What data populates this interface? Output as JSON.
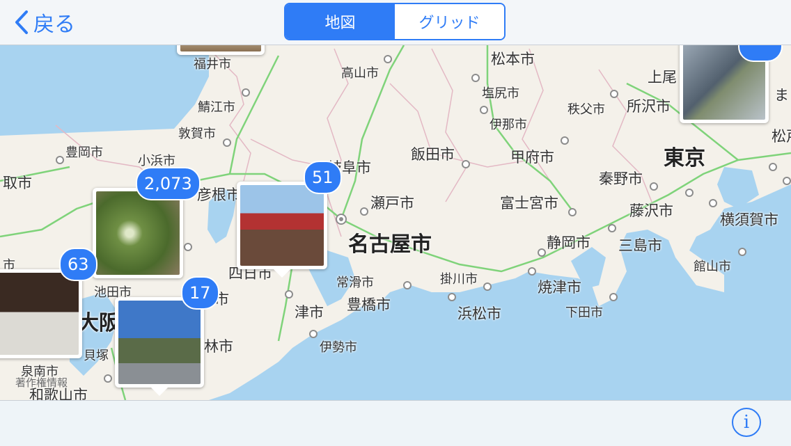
{
  "nav": {
    "back_label": "戻る",
    "segments": [
      {
        "label": "地図",
        "selected": true
      },
      {
        "label": "グリッド",
        "selected": false
      }
    ]
  },
  "map": {
    "cities": [
      {
        "name": "福井市"
      },
      {
        "name": "高山市"
      },
      {
        "name": "松本市"
      },
      {
        "name": "上尾"
      },
      {
        "name": "鯖江市"
      },
      {
        "name": "塩尻市"
      },
      {
        "name": "秩父市"
      },
      {
        "name": "所沢市"
      },
      {
        "name": "敦賀市"
      },
      {
        "name": "伊那市"
      },
      {
        "name": "松戸"
      },
      {
        "name": "豊岡市"
      },
      {
        "name": "小浜市"
      },
      {
        "name": "岐阜市"
      },
      {
        "name": "飯田市"
      },
      {
        "name": "甲府市"
      },
      {
        "name": "東京"
      },
      {
        "name": "取市"
      },
      {
        "name": "彦根市"
      },
      {
        "name": "瀬戸市"
      },
      {
        "name": "富士宮市"
      },
      {
        "name": "秦野市"
      },
      {
        "name": "名古屋市"
      },
      {
        "name": "藤沢市"
      },
      {
        "name": "横須賀市"
      },
      {
        "name": "静岡市"
      },
      {
        "name": "三島市"
      },
      {
        "name": "四日市"
      },
      {
        "name": "常滑市"
      },
      {
        "name": "掛川市"
      },
      {
        "name": "焼津市"
      },
      {
        "name": "館山市"
      },
      {
        "name": "池田市"
      },
      {
        "name": "豊橋市"
      },
      {
        "name": "津市"
      },
      {
        "name": "浜松市"
      },
      {
        "name": "下田市"
      },
      {
        "name": "大阪"
      },
      {
        "name": "伊勢市"
      },
      {
        "name": "林市"
      },
      {
        "name": "貝塚"
      },
      {
        "name": "泉南市"
      },
      {
        "name": "和歌山市"
      },
      {
        "name": "市"
      },
      {
        "name": "市"
      },
      {
        "name": "ま"
      }
    ],
    "clusters": [
      {
        "count": "2,073",
        "photo_color": "#5c7a3e"
      },
      {
        "count": "51",
        "photo_color": "#b03a3a"
      },
      {
        "count": "63",
        "photo_color": "#8a6a4a"
      },
      {
        "count": "17",
        "photo_color": "#4a6fa8"
      }
    ],
    "credit": "著作権情報"
  },
  "bottom": {
    "info_icon": "info-icon"
  },
  "colors": {
    "accent": "#2f7cf6",
    "sea": "#a8d3f0",
    "land": "#f4f1ea",
    "road": "#7fd37a",
    "border": "#e3b8c4"
  }
}
